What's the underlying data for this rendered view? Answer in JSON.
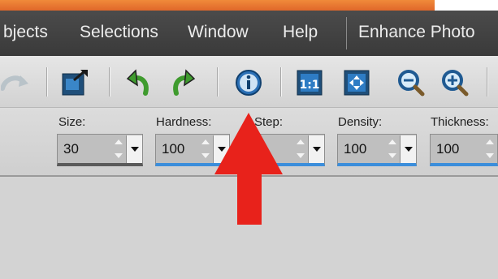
{
  "menubar": {
    "items": [
      {
        "label": "bjects",
        "name": "menu-objects"
      },
      {
        "label": "Selections",
        "name": "menu-selections"
      },
      {
        "label": "Window",
        "name": "menu-window"
      },
      {
        "label": "Help",
        "name": "menu-help"
      },
      {
        "label": "Enhance Photo",
        "name": "menu-enhance-photo"
      }
    ]
  },
  "toolbar": {
    "icons": [
      "redo-faded-icon",
      "save-export-icon",
      "rotate-left-icon",
      "rotate-right-icon",
      "info-icon",
      "actual-size-icon",
      "fit-to-window-icon",
      "zoom-out-icon",
      "zoom-in-icon"
    ]
  },
  "options": {
    "size": {
      "label": "Size:",
      "value": "30"
    },
    "hardness": {
      "label": "Hardness:",
      "value": "100"
    },
    "step": {
      "label": "Step:",
      "value": ""
    },
    "density": {
      "label": "Density:",
      "value": "100"
    },
    "thickness": {
      "label": "Thickness:",
      "value": "100"
    }
  },
  "colors": {
    "accent_orange": "#e0672a",
    "menubar": "#3f3f3f",
    "active_underline": "#3b8edb",
    "annotation_arrow": "#e8221b"
  }
}
